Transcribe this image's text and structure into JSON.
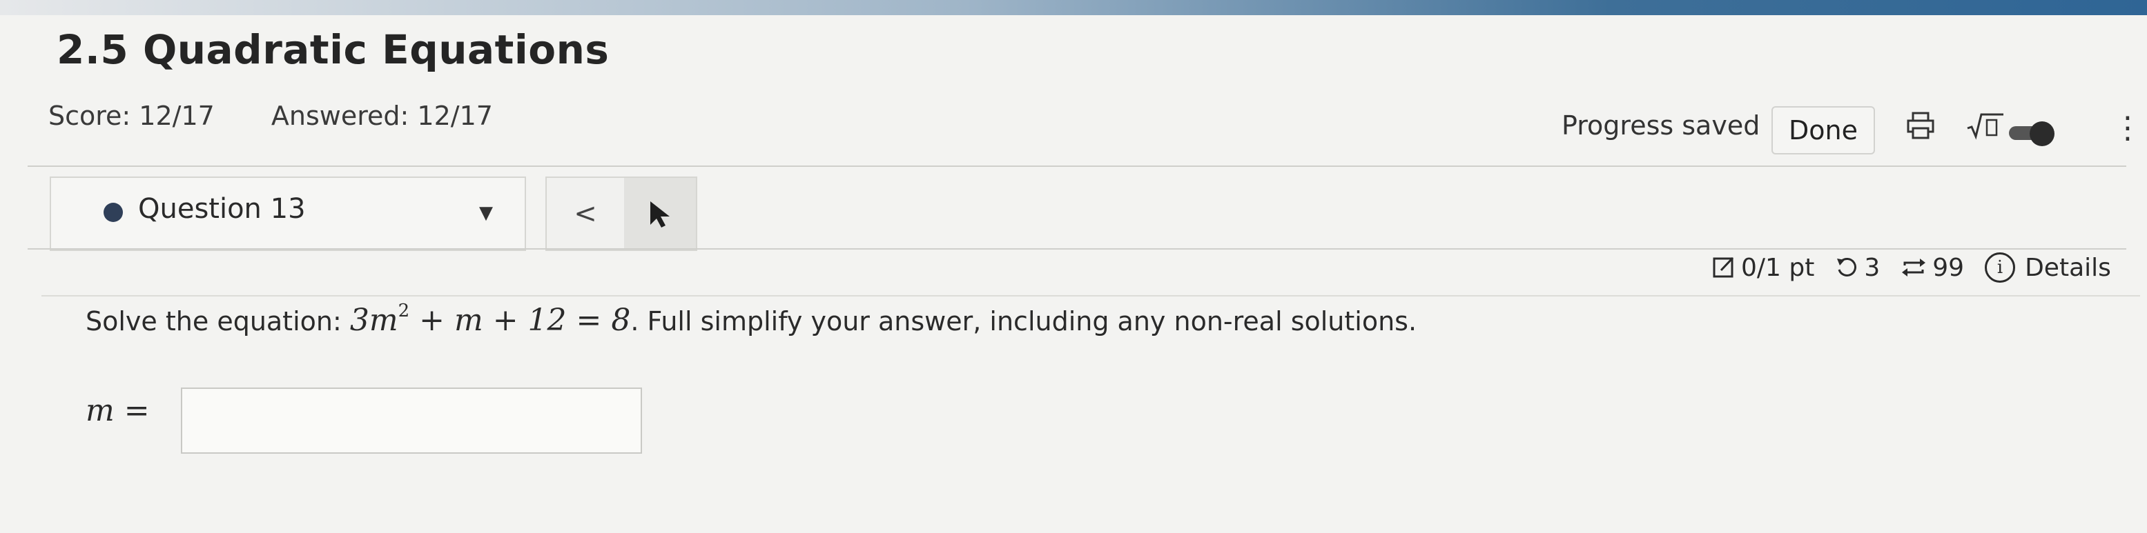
{
  "header": {
    "title": "2.5 Quadratic Equations",
    "score": "Score: 12/17",
    "answered": "Answered: 12/17",
    "progress_saved": "Progress saved",
    "done_label": "Done",
    "icons": [
      "print-icon",
      "sqrt-icon",
      "toggle",
      "kebab-menu-icon"
    ]
  },
  "question_nav": {
    "label": "Question 13",
    "prev_glyph": "<"
  },
  "meta": {
    "points": "0/1 pt",
    "retries": "3",
    "attempts": "99",
    "details": "Details"
  },
  "question": {
    "prompt_prefix": "Solve the equation:",
    "eq_part1": "3m",
    "eq_exp": "2",
    "eq_part2": " + m + 12 = 8",
    "prompt_suffix": ". Full simplify your answer, including any non-real solutions.",
    "answer_label": "m ="
  },
  "colors": {
    "background": "#f3f3f1",
    "accent_dot": "#2f3f58",
    "topbar": "#2f6595"
  }
}
